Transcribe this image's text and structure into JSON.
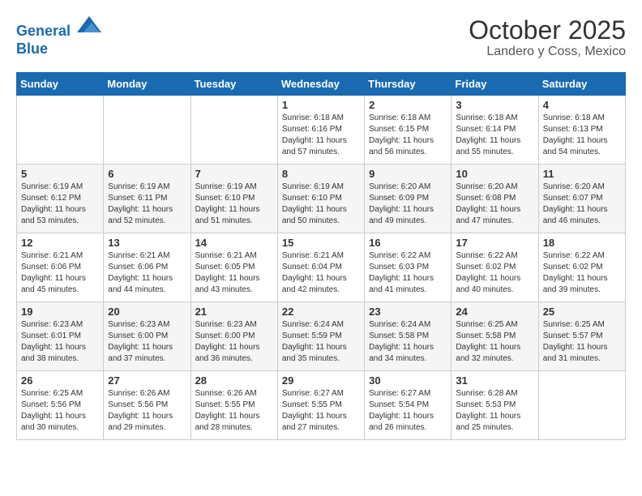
{
  "header": {
    "logo_line1": "General",
    "logo_line2": "Blue",
    "month": "October 2025",
    "location": "Landero y Coss, Mexico"
  },
  "weekdays": [
    "Sunday",
    "Monday",
    "Tuesday",
    "Wednesday",
    "Thursday",
    "Friday",
    "Saturday"
  ],
  "weeks": [
    [
      {
        "day": "",
        "sunrise": "",
        "sunset": "",
        "daylight": ""
      },
      {
        "day": "",
        "sunrise": "",
        "sunset": "",
        "daylight": ""
      },
      {
        "day": "",
        "sunrise": "",
        "sunset": "",
        "daylight": ""
      },
      {
        "day": "1",
        "sunrise": "Sunrise: 6:18 AM",
        "sunset": "Sunset: 6:16 PM",
        "daylight": "Daylight: 11 hours and 57 minutes."
      },
      {
        "day": "2",
        "sunrise": "Sunrise: 6:18 AM",
        "sunset": "Sunset: 6:15 PM",
        "daylight": "Daylight: 11 hours and 56 minutes."
      },
      {
        "day": "3",
        "sunrise": "Sunrise: 6:18 AM",
        "sunset": "Sunset: 6:14 PM",
        "daylight": "Daylight: 11 hours and 55 minutes."
      },
      {
        "day": "4",
        "sunrise": "Sunrise: 6:18 AM",
        "sunset": "Sunset: 6:13 PM",
        "daylight": "Daylight: 11 hours and 54 minutes."
      }
    ],
    [
      {
        "day": "5",
        "sunrise": "Sunrise: 6:19 AM",
        "sunset": "Sunset: 6:12 PM",
        "daylight": "Daylight: 11 hours and 53 minutes."
      },
      {
        "day": "6",
        "sunrise": "Sunrise: 6:19 AM",
        "sunset": "Sunset: 6:11 PM",
        "daylight": "Daylight: 11 hours and 52 minutes."
      },
      {
        "day": "7",
        "sunrise": "Sunrise: 6:19 AM",
        "sunset": "Sunset: 6:10 PM",
        "daylight": "Daylight: 11 hours and 51 minutes."
      },
      {
        "day": "8",
        "sunrise": "Sunrise: 6:19 AM",
        "sunset": "Sunset: 6:10 PM",
        "daylight": "Daylight: 11 hours and 50 minutes."
      },
      {
        "day": "9",
        "sunrise": "Sunrise: 6:20 AM",
        "sunset": "Sunset: 6:09 PM",
        "daylight": "Daylight: 11 hours and 49 minutes."
      },
      {
        "day": "10",
        "sunrise": "Sunrise: 6:20 AM",
        "sunset": "Sunset: 6:08 PM",
        "daylight": "Daylight: 11 hours and 47 minutes."
      },
      {
        "day": "11",
        "sunrise": "Sunrise: 6:20 AM",
        "sunset": "Sunset: 6:07 PM",
        "daylight": "Daylight: 11 hours and 46 minutes."
      }
    ],
    [
      {
        "day": "12",
        "sunrise": "Sunrise: 6:21 AM",
        "sunset": "Sunset: 6:06 PM",
        "daylight": "Daylight: 11 hours and 45 minutes."
      },
      {
        "day": "13",
        "sunrise": "Sunrise: 6:21 AM",
        "sunset": "Sunset: 6:06 PM",
        "daylight": "Daylight: 11 hours and 44 minutes."
      },
      {
        "day": "14",
        "sunrise": "Sunrise: 6:21 AM",
        "sunset": "Sunset: 6:05 PM",
        "daylight": "Daylight: 11 hours and 43 minutes."
      },
      {
        "day": "15",
        "sunrise": "Sunrise: 6:21 AM",
        "sunset": "Sunset: 6:04 PM",
        "daylight": "Daylight: 11 hours and 42 minutes."
      },
      {
        "day": "16",
        "sunrise": "Sunrise: 6:22 AM",
        "sunset": "Sunset: 6:03 PM",
        "daylight": "Daylight: 11 hours and 41 minutes."
      },
      {
        "day": "17",
        "sunrise": "Sunrise: 6:22 AM",
        "sunset": "Sunset: 6:02 PM",
        "daylight": "Daylight: 11 hours and 40 minutes."
      },
      {
        "day": "18",
        "sunrise": "Sunrise: 6:22 AM",
        "sunset": "Sunset: 6:02 PM",
        "daylight": "Daylight: 11 hours and 39 minutes."
      }
    ],
    [
      {
        "day": "19",
        "sunrise": "Sunrise: 6:23 AM",
        "sunset": "Sunset: 6:01 PM",
        "daylight": "Daylight: 11 hours and 38 minutes."
      },
      {
        "day": "20",
        "sunrise": "Sunrise: 6:23 AM",
        "sunset": "Sunset: 6:00 PM",
        "daylight": "Daylight: 11 hours and 37 minutes."
      },
      {
        "day": "21",
        "sunrise": "Sunrise: 6:23 AM",
        "sunset": "Sunset: 6:00 PM",
        "daylight": "Daylight: 11 hours and 36 minutes."
      },
      {
        "day": "22",
        "sunrise": "Sunrise: 6:24 AM",
        "sunset": "Sunset: 5:59 PM",
        "daylight": "Daylight: 11 hours and 35 minutes."
      },
      {
        "day": "23",
        "sunrise": "Sunrise: 6:24 AM",
        "sunset": "Sunset: 5:58 PM",
        "daylight": "Daylight: 11 hours and 34 minutes."
      },
      {
        "day": "24",
        "sunrise": "Sunrise: 6:25 AM",
        "sunset": "Sunset: 5:58 PM",
        "daylight": "Daylight: 11 hours and 32 minutes."
      },
      {
        "day": "25",
        "sunrise": "Sunrise: 6:25 AM",
        "sunset": "Sunset: 5:57 PM",
        "daylight": "Daylight: 11 hours and 31 minutes."
      }
    ],
    [
      {
        "day": "26",
        "sunrise": "Sunrise: 6:25 AM",
        "sunset": "Sunset: 5:56 PM",
        "daylight": "Daylight: 11 hours and 30 minutes."
      },
      {
        "day": "27",
        "sunrise": "Sunrise: 6:26 AM",
        "sunset": "Sunset: 5:56 PM",
        "daylight": "Daylight: 11 hours and 29 minutes."
      },
      {
        "day": "28",
        "sunrise": "Sunrise: 6:26 AM",
        "sunset": "Sunset: 5:55 PM",
        "daylight": "Daylight: 11 hours and 28 minutes."
      },
      {
        "day": "29",
        "sunrise": "Sunrise: 6:27 AM",
        "sunset": "Sunset: 5:55 PM",
        "daylight": "Daylight: 11 hours and 27 minutes."
      },
      {
        "day": "30",
        "sunrise": "Sunrise: 6:27 AM",
        "sunset": "Sunset: 5:54 PM",
        "daylight": "Daylight: 11 hours and 26 minutes."
      },
      {
        "day": "31",
        "sunrise": "Sunrise: 6:28 AM",
        "sunset": "Sunset: 5:53 PM",
        "daylight": "Daylight: 11 hours and 25 minutes."
      },
      {
        "day": "",
        "sunrise": "",
        "sunset": "",
        "daylight": ""
      }
    ]
  ]
}
